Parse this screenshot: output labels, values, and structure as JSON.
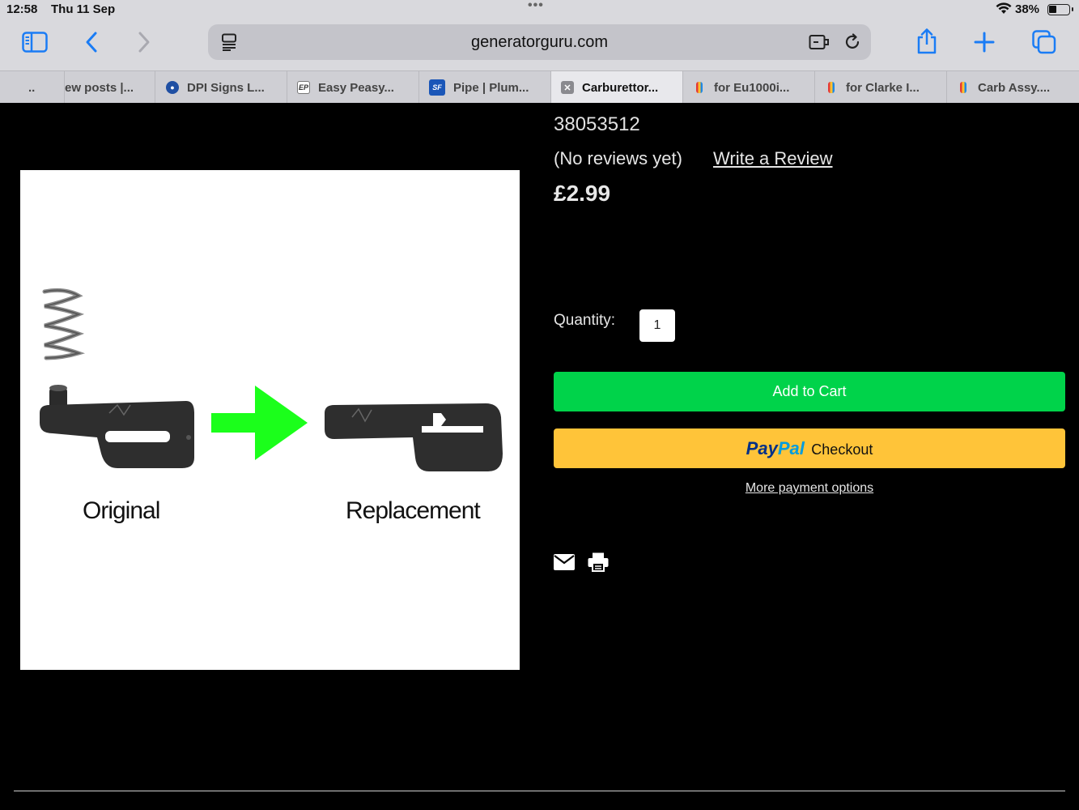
{
  "status_bar": {
    "time": "12:58",
    "date": "Thu 11 Sep",
    "battery_pct": "38%",
    "battery_level": 0.38
  },
  "browser": {
    "url": "generatorguru.com",
    "accent_color": "#1a7cf5",
    "tabs": [
      {
        "label": "..",
        "icon": "none",
        "active": false
      },
      {
        "label": "ew posts |...",
        "icon": "none",
        "active": false
      },
      {
        "label": "DPI Signs L...",
        "icon": "dpi-favicon",
        "active": false
      },
      {
        "label": "Easy Peasy...",
        "icon": "epf-favicon",
        "active": false
      },
      {
        "label": "Pipe | Plum...",
        "icon": "sf-favicon",
        "active": false
      },
      {
        "label": "Carburettor...",
        "icon": "close-icon",
        "active": true
      },
      {
        "label": "for Eu1000i...",
        "icon": "marker-favicon",
        "active": false
      },
      {
        "label": "for Clarke I...",
        "icon": "marker-favicon",
        "active": false
      },
      {
        "label": "Carb Assy....",
        "icon": "marker-favicon",
        "active": false
      }
    ]
  },
  "product": {
    "sku": "38053512",
    "reviews_text": "(No reviews yet)",
    "write_review": "Write a Review",
    "price": "£2.99",
    "quantity_label": "Quantity:",
    "quantity_value": "1",
    "add_to_cart": "Add to Cart",
    "paypal_pay": "Pay",
    "paypal_pal": "Pal",
    "paypal_checkout": "Checkout",
    "more_payment": "More payment options",
    "image_caption_left": "Original",
    "image_caption_right": "Replacement",
    "add_to_cart_color": "#00d34a",
    "paypal_color": "#ffc439"
  }
}
